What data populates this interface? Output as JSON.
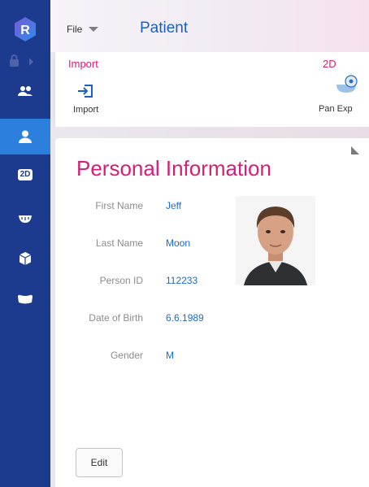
{
  "header": {
    "file_menu": "File",
    "title": "Patient"
  },
  "ribbon": {
    "groups": [
      {
        "title": "Import",
        "buttons": [
          {
            "label": "Import"
          }
        ]
      },
      {
        "title": "2D",
        "buttons": [
          {
            "label": "Pan Exp"
          }
        ]
      }
    ]
  },
  "sidebar": {
    "logo_letter": "R",
    "items": [
      {
        "icon": "patients-icon"
      },
      {
        "icon": "person-icon",
        "active": true
      },
      {
        "icon": "2d-icon",
        "label": "2D"
      },
      {
        "icon": "dental-arch-icon"
      },
      {
        "icon": "3d-model-icon"
      },
      {
        "icon": "jaw-icon"
      }
    ]
  },
  "personal_info": {
    "title": "Personal Information",
    "fields": [
      {
        "label": "First Name",
        "value": "Jeff"
      },
      {
        "label": "Last Name",
        "value": "Moon"
      },
      {
        "label": "Person ID",
        "value": "112233"
      },
      {
        "label": "Date of Birth",
        "value": "6.6.1989"
      },
      {
        "label": "Gender",
        "value": "M"
      }
    ],
    "edit_label": "Edit"
  },
  "colors": {
    "sidebar": "#1c3a8e",
    "sidebar_active": "#2c7fdc",
    "accent_magenta": "#d51e78",
    "accent_blue": "#1a6bd1"
  }
}
